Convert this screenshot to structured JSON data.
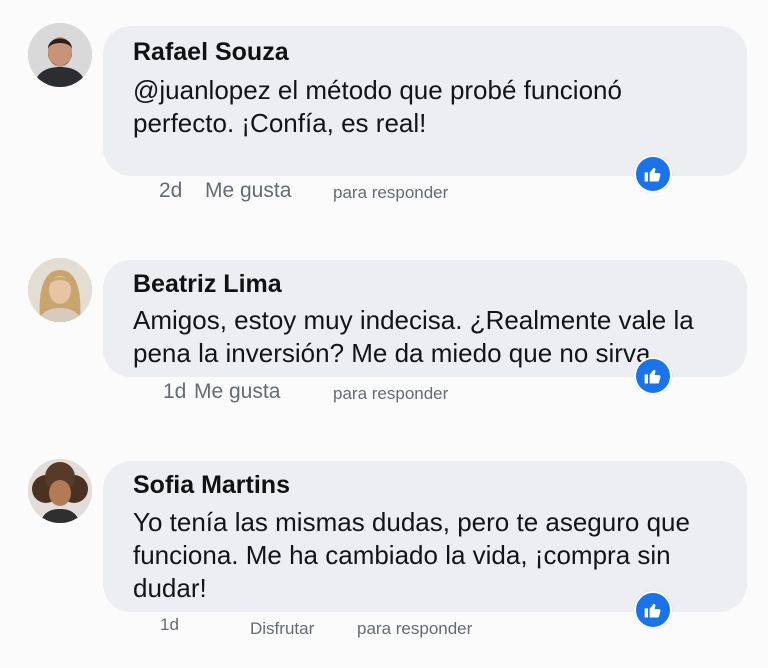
{
  "comments": [
    {
      "author": "Rafael Souza",
      "text_lines": [
        "@juanlopez el método que probé funcionó",
        "perfecto. ¡Confía, es real!"
      ],
      "time": "2d",
      "like_label": "Me gusta",
      "reply_label": "para responder",
      "avatar": "man-beard-avatar"
    },
    {
      "author": "Beatriz Lima",
      "text_lines": [
        "Amigos, estoy muy indecisa. ¿Realmente vale la",
        "pena la inversión? Me da miedo que no sirva."
      ],
      "time": "1d",
      "like_label": "Me gusta",
      "reply_label": "para responder",
      "avatar": "blonde-woman-avatar"
    },
    {
      "author": "Sofia Martins",
      "text_lines": [
        "Yo tenía las mismas dudas, pero te aseguro que",
        "funciona. Me ha cambiado la vida, ¡compra sin",
        "dudar!"
      ],
      "time": "1d",
      "like_label": "Disfrutar",
      "reply_label": "para responder",
      "avatar": "curly-hair-woman-avatar"
    }
  ],
  "colors": {
    "bubble": "#eceef2",
    "like_badge": "#1a73e8",
    "meta_text": "#666b73"
  },
  "icons": {
    "like": "thumbs-up-icon"
  }
}
